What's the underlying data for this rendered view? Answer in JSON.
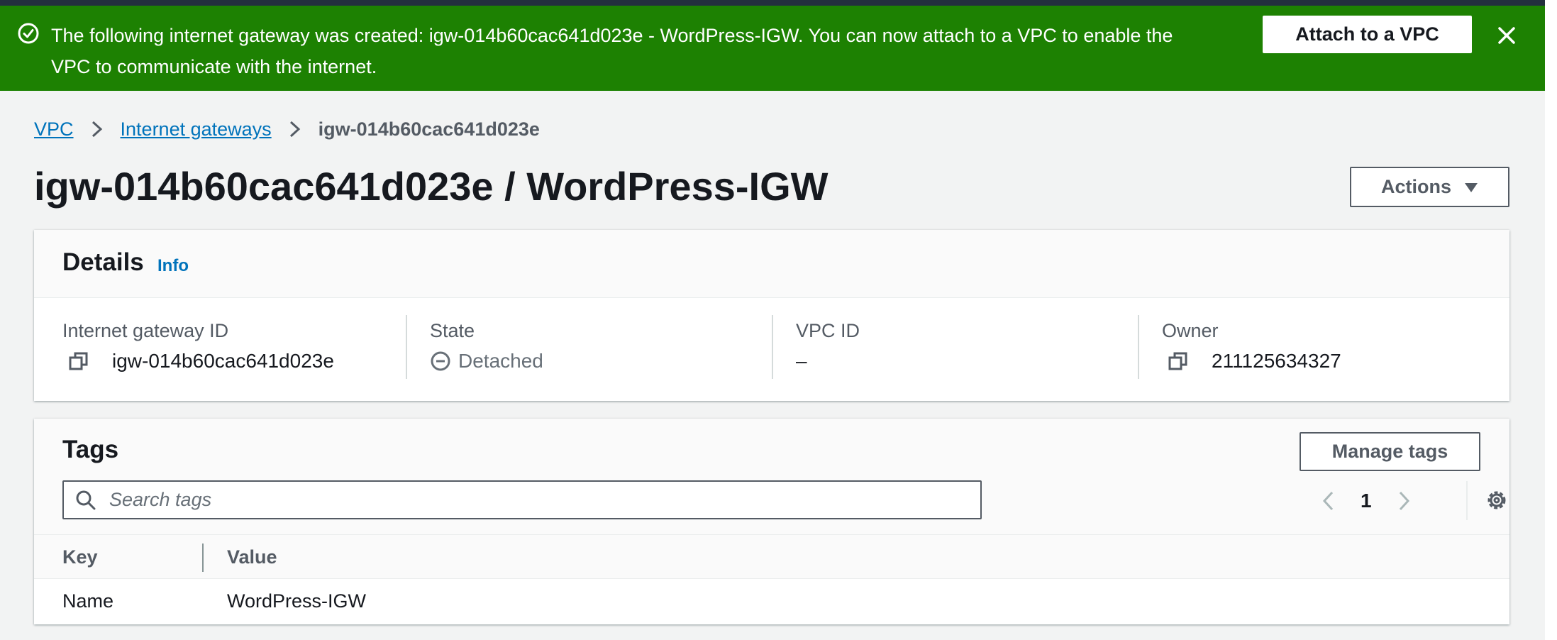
{
  "flash": {
    "message": "The following internet gateway was created: igw-014b60cac641d023e - WordPress-IGW. You can now attach to a VPC to enable the VPC to communicate with the internet.",
    "attach_button": "Attach to a VPC",
    "success_icon": "check-circle-icon",
    "close_icon": "close-icon",
    "color": "#1d8102"
  },
  "breadcrumb": {
    "items": [
      "VPC",
      "Internet gateways"
    ],
    "current": "igw-014b60cac641d023e"
  },
  "page": {
    "title": "igw-014b60cac641d023e / WordPress-IGW",
    "actions_label": "Actions"
  },
  "details": {
    "title": "Details",
    "info": "Info",
    "fields": [
      {
        "label": "Internet gateway ID",
        "value": "igw-014b60cac641d023e"
      },
      {
        "label": "State",
        "value": "Detached"
      },
      {
        "label": "VPC ID",
        "value": "–"
      },
      {
        "label": "Owner",
        "value": "211125634327"
      }
    ]
  },
  "tags": {
    "title": "Tags",
    "manage_label": "Manage tags",
    "search_placeholder": "Search tags",
    "page": "1",
    "columns": [
      "Key",
      "Value"
    ],
    "rows": [
      {
        "key": "Name",
        "value": "WordPress-IGW"
      }
    ]
  },
  "colors": {
    "link": "#0073bb",
    "success": "#1d8102",
    "text": "#16191f",
    "muted": "#545b64"
  }
}
